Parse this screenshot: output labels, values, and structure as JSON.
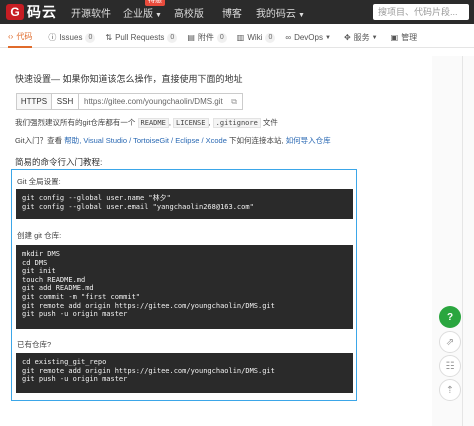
{
  "nav": {
    "logo_text": "码云",
    "items": [
      {
        "label": "开源软件"
      },
      {
        "label": "企业版"
      },
      {
        "label": "高校版"
      },
      {
        "label": "博客"
      },
      {
        "label": "我的码云"
      }
    ],
    "hot_badge": "特惠",
    "search_placeholder": "搜项目、代码片段..."
  },
  "tabs": [
    {
      "label": "代码",
      "icon": "code-icon",
      "count": ""
    },
    {
      "label": "Issues",
      "icon": "issue-icon",
      "count": "0"
    },
    {
      "label": "Pull Requests",
      "icon": "pr-icon",
      "count": "0"
    },
    {
      "label": "附件",
      "icon": "attachment-icon",
      "count": "0"
    },
    {
      "label": "Wiki",
      "icon": "wiki-icon",
      "count": "0"
    },
    {
      "label": "DevOps",
      "icon": "devops-icon",
      "count": ""
    },
    {
      "label": "服务",
      "icon": "service-icon",
      "count": ""
    },
    {
      "label": "管理",
      "icon": "manage-icon",
      "count": ""
    }
  ],
  "quick": {
    "title": "快速设置— 如果你知道该怎么操作，直接使用下面的地址",
    "https": "HTTPS",
    "ssh": "SSH",
    "url": "https://gitee.com/youngchaolin/DMS.git"
  },
  "line1": {
    "pre": "我们强烈建议所有的git仓库都有一个",
    "readme": "README",
    "license": "LICENSE",
    "gitignore": ".gitignore",
    "post": "文件"
  },
  "line2": {
    "pre": "Git入门？查看",
    "help": "帮助",
    "tools": ", Visual Studio / TortoiseGit / Eclipse / Xcode",
    "mid": "下如何连接本站,",
    "import": "如何导入仓库"
  },
  "tutorial_title": "简易的命令行入门教程:",
  "sections": [
    {
      "label": "Git 全局设置:",
      "code": "git config --global user.name \"林夕\"\ngit config --global user.email \"yangchaolin268@163.com\""
    },
    {
      "label": "创建 git 仓库:",
      "code": "mkdir DMS\ncd DMS\ngit init\ntouch README.md\ngit add README.md\ngit commit -m \"first commit\"\ngit remote add origin https://gitee.com/youngchaolin/DMS.git\ngit push -u origin master"
    },
    {
      "label": "已有仓库?",
      "code": "cd existing_git_repo\ngit remote add origin https://gitee.com/youngchaolin/DMS.git\ngit push -u origin master"
    }
  ],
  "fabs": {
    "help": "?",
    "share": "⇗",
    "chat": "☷",
    "top": "⇡"
  },
  "colors": {
    "accent": "#e06b2b",
    "brand": "#c71d23",
    "highlight_border": "#3ba6e8",
    "help_green": "#2aa63f"
  }
}
